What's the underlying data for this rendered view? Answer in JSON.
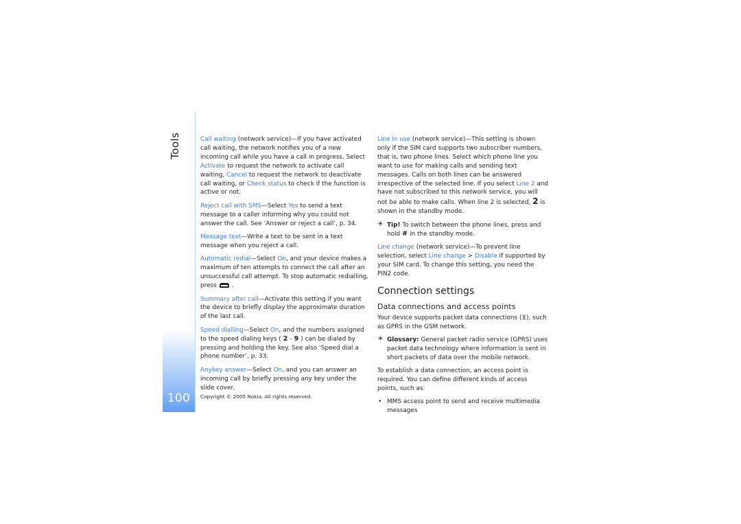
{
  "section_title": "Tools",
  "page_number": "100",
  "copyright": "Copyright © 2005 Nokia. All rights reserved.",
  "colors": {
    "link": "#3b7de0",
    "page_block": "#5f9ef3",
    "rule": "#b9d8f4"
  },
  "left_column": {
    "call_waiting": {
      "term": "Call waiting",
      "t1": " (network service)—If you have activated call waiting, the network notifies you of a new incoming call while you have a call in progress. Select ",
      "l1": "Activate",
      "t2": " to request the network to activate call waiting, ",
      "l2": "Cancel",
      "t3": " to request the network to deactivate call waiting, or ",
      "l3": "Check status",
      "t4": " to check if the function is active or not."
    },
    "reject_sms": {
      "term": "Reject call with SMS",
      "t1": "—Select ",
      "l1": "Yes",
      "t2": " to send a text message to a caller informing why you could not answer the call. See ‘Answer or reject a call’, p. 34."
    },
    "message_text": {
      "term": "Message text",
      "t1": "—Write a text to be sent in a text message when you reject a call."
    },
    "auto_redial": {
      "term": "Automatic redial",
      "t1": "—Select ",
      "l1": "On",
      "t2": ", and your device makes a maximum of ten attempts to connect the call after an unsuccessful call attempt. To stop automatic redialling, press",
      "icon": "end-call-key-icon",
      "t3": "."
    },
    "summary": {
      "term": "Summary after call",
      "t1": "—Activate this setting if you want the device to briefly display the approximate duration of the last call."
    },
    "speed_dialling": {
      "term": "Speed dialling",
      "t1": "—Select ",
      "l1": "On",
      "t2": ", and the numbers assigned to the speed dialing keys (",
      "k1": "2",
      "dash": "-",
      "k2": "9",
      "t3": ") can be dialed by pressing and holding the key. See also ‘Speed dial a phone number’, p. 33."
    },
    "anykey": {
      "term": "Anykey answer",
      "t1": "—Select ",
      "l1": "On",
      "t2": ", and you can answer an incoming call by briefly pressing any key under the slide cover."
    }
  },
  "right_column": {
    "line_in_use": {
      "term": "Line in use",
      "t1": " (network service)—This setting is shown only if the SIM card supports two subscriber numbers, that is, two phone lines. Select which phone line you want to use for making calls and sending text messages. Calls on both lines can be answered irrespective of the selected line. If you select ",
      "l1": "Line 2",
      "t2": " and have not subscribed to this network service, you will not be able to make calls. When line 2 is selected,",
      "k1": "2",
      "t3": "is shown in the standby mode."
    },
    "tip": {
      "icon": "tip-bulb-icon",
      "label": "Tip!",
      "t1": " To switch between the phone lines, press and hold",
      "k1": "#",
      "t2": "in the standby mode."
    },
    "line_change": {
      "term": "Line change",
      "t1": " (network service)—To prevent line selection, select ",
      "l1": "Line change",
      "sep": " > ",
      "l2": "Disable",
      "t2": " if supported by your SIM card. To change this setting, you need the PIN2 code."
    },
    "heading": "Connection settings",
    "subheading": "Data connections and access points",
    "data_intro": {
      "t1": "Your device supports packet data connections (",
      "icon": "packet-data-icon",
      "t2": "), such as GPRS in the GSM network."
    },
    "glossary": {
      "icon": "glossary-bulb-icon",
      "label": "Glossary:",
      "t1": " General packet radio service (GPRS) uses packet data technology where information is sent in short packets of data over the mobile network."
    },
    "access_point": "To establish a data connection, an access point is required. You can define different kinds of access points, such as:",
    "bullets": [
      "MMS access point to send and receive multimedia messages"
    ]
  }
}
